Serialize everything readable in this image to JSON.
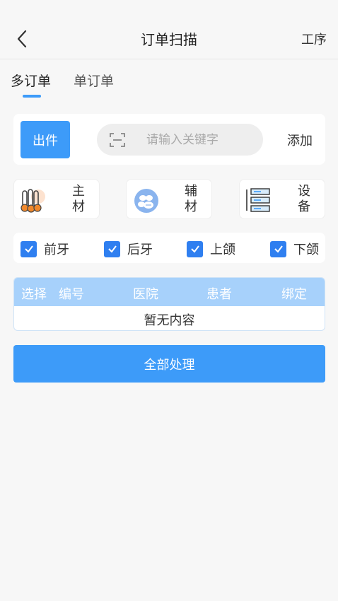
{
  "header": {
    "title": "订单扫描",
    "right_action": "工序"
  },
  "tabs": [
    {
      "label": "多订单",
      "active": true
    },
    {
      "label": "单订单",
      "active": false
    }
  ],
  "scan": {
    "out_button": "出件",
    "search_placeholder": "请输入关键字",
    "search_value": "",
    "add_button": "添加"
  },
  "materials": [
    {
      "label": "主材",
      "icon": "main-material-icon"
    },
    {
      "label": "辅材",
      "icon": "auxiliary-material-icon"
    },
    {
      "label": "设备",
      "icon": "equipment-server-icon"
    }
  ],
  "filters": [
    {
      "label": "前牙",
      "checked": true
    },
    {
      "label": "后牙",
      "checked": true
    },
    {
      "label": "上颌",
      "checked": true
    },
    {
      "label": "下颌",
      "checked": true
    }
  ],
  "table": {
    "columns": [
      "选择",
      "编号",
      "医院",
      "患者",
      "绑定"
    ],
    "empty_text": "暂无内容"
  },
  "process_button": "全部处理",
  "colors": {
    "accent": "#3d9bf9",
    "table_header": "#a7d1fb",
    "checkbox": "#2f7ff0"
  }
}
